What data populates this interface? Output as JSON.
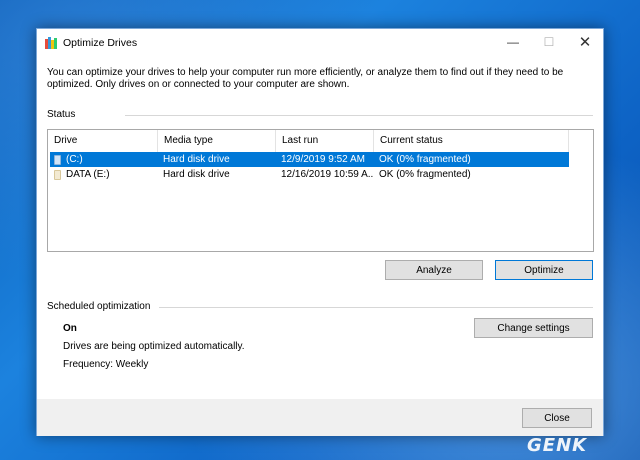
{
  "window": {
    "title": "Optimize Drives",
    "minimize_glyph": "—",
    "maximize_glyph": "☐",
    "close_glyph": "✕"
  },
  "intro": {
    "line1": "You can optimize your drives to help your computer run more efficiently, or analyze them to find out if they need to be",
    "line2": "optimized. Only drives on or connected to your computer are shown."
  },
  "status_group": {
    "label": "Status",
    "columns": [
      "Drive",
      "Media type",
      "Last run",
      "Current status"
    ],
    "drives": [
      {
        "drive": "(C:)",
        "media_type": "Hard disk drive",
        "last_run": "12/9/2019 9:52 AM",
        "current_status": "OK (0% fragmented)",
        "selected": true
      },
      {
        "drive": "DATA (E:)",
        "media_type": "Hard disk drive",
        "last_run": "12/16/2019 10:59 A...",
        "current_status": "OK (0% fragmented)",
        "selected": false
      }
    ]
  },
  "buttons": {
    "analyze": "Analyze",
    "optimize": "Optimize",
    "change_settings": "Change settings",
    "close": "Close"
  },
  "scheduled": {
    "label": "Scheduled optimization",
    "state": "On",
    "description": "Drives are being optimized automatically.",
    "frequency": "Frequency: Weekly"
  },
  "watermark": {
    "text": "GENK"
  },
  "colors": {
    "selection": "#0078d7",
    "desktop": "#1c82de",
    "button_face": "#e1e1e1",
    "footer": "#f0f0f0"
  },
  "icons": {
    "app": "optimize-drives-icon",
    "system_drive": "windows-drive-icon",
    "data_drive": "drive-icon"
  }
}
